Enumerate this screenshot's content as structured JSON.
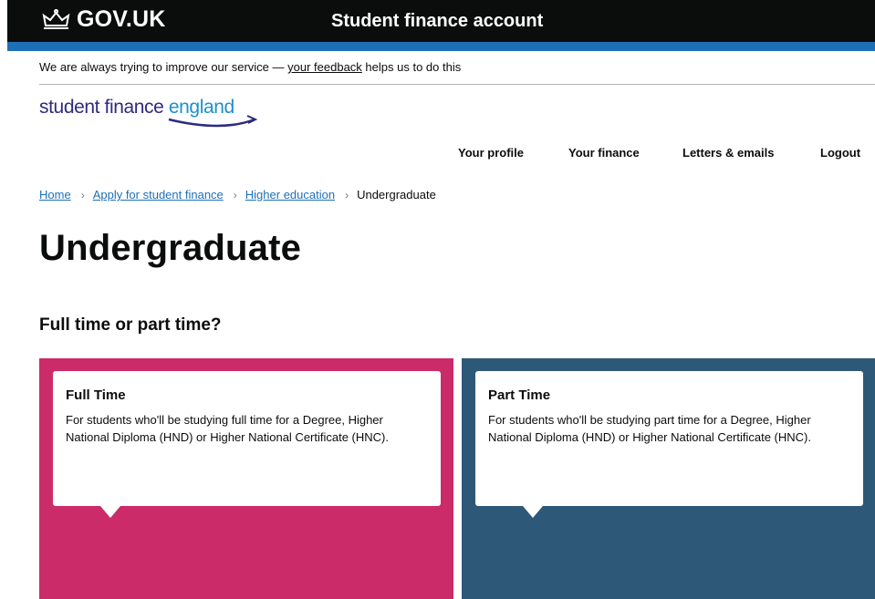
{
  "header": {
    "logo_text": "GOV.UK",
    "service_name": "Student finance account",
    "colors": {
      "background": "#0b0c0c",
      "strip": "#1d70b8"
    }
  },
  "phase_banner": {
    "text_before": "We are always trying to improve our service — ",
    "link_text": "your feedback",
    "text_after": " helps us to do this"
  },
  "brand": {
    "part1": "student finance ",
    "part2": "england"
  },
  "nav": {
    "items": [
      {
        "label": "Your profile"
      },
      {
        "label": "Your finance"
      },
      {
        "label": "Letters & emails"
      },
      {
        "label": "Logout"
      }
    ]
  },
  "breadcrumbs": {
    "items": [
      {
        "label": "Home"
      },
      {
        "label": "Apply for student finance"
      },
      {
        "label": "Higher education"
      }
    ],
    "current": "Undergraduate"
  },
  "page": {
    "title": "Undergraduate",
    "section_heading": "Full time or part time?"
  },
  "options": [
    {
      "title": "Full Time",
      "description": "For students who'll be studying full time for a Degree, Higher National Diploma (HND) or Higher National Certificate (HNC).",
      "color": "#cc2b6a"
    },
    {
      "title": "Part Time",
      "description": "For students who'll be studying part time for a Degree, Higher National Diploma (HND) or Higher National Certificate (HNC).",
      "color": "#2e5878"
    }
  ]
}
